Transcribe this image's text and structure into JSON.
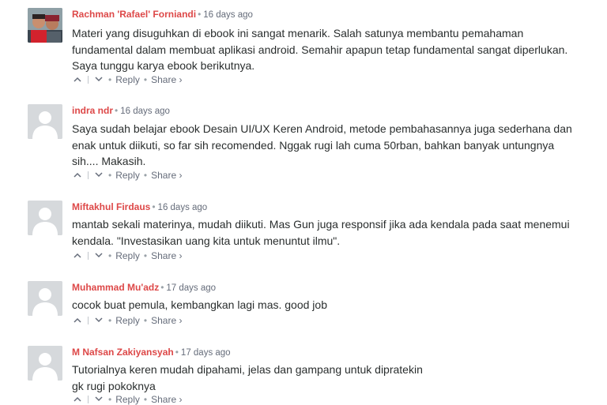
{
  "comments": [
    {
      "author": "Rachman 'Rafael' Forniandi",
      "time": "16 days ago",
      "avatar": "user-photo",
      "lines": [
        "Materi yang disuguhkan di ebook ini sangat menarik. Salah satunya membantu pemahaman",
        "fundamental dalam membuat aplikasi android. Semahir apapun tetap fundamental sangat diperlukan.",
        "Saya tunggu karya ebook berikutnya."
      ],
      "reply_label": "Reply",
      "share_label": "Share ›"
    },
    {
      "author": "indra ndr",
      "time": "16 days ago",
      "avatar": "default-avatar",
      "lines": [
        "Saya sudah belajar ebook Desain UI/UX Keren Android, metode pembahasannya juga sederhana dan",
        "enak untuk diikuti, so far sih recomended. Nggak rugi lah cuma 50rban, bahkan banyak untungnya",
        "sih.... Makasih."
      ],
      "reply_label": "Reply",
      "share_label": "Share ›"
    },
    {
      "author": "Miftakhul Firdaus",
      "time": "16 days ago",
      "avatar": "default-avatar",
      "lines": [
        "mantab sekali materinya, mudah diikuti. Mas Gun juga responsif jika ada kendala pada saat menemui",
        "kendala. \"Investasikan uang kita untuk menuntut ilmu\"."
      ],
      "reply_label": "Reply",
      "share_label": "Share ›"
    },
    {
      "author": "Muhammad Mu'adz",
      "time": "17 days ago",
      "avatar": "default-avatar",
      "lines": [
        "cocok buat pemula, kembangkan lagi mas. good job"
      ],
      "reply_label": "Reply",
      "share_label": "Share ›"
    },
    {
      "author": "M Nafsan Zakiyansyah",
      "time": "17 days ago",
      "avatar": "default-avatar",
      "lines": [
        "Tutorialnya keren mudah dipahami, jelas dan gampang untuk dipratekin",
        "gk rugi pokoknya"
      ],
      "reply_label": "Reply",
      "share_label": "Share ›"
    }
  ],
  "colors": {
    "author": "#dd4848",
    "meta": "#656c7a",
    "text": "#2a2e2e",
    "avatar_placeholder": "#d6d9dc"
  }
}
